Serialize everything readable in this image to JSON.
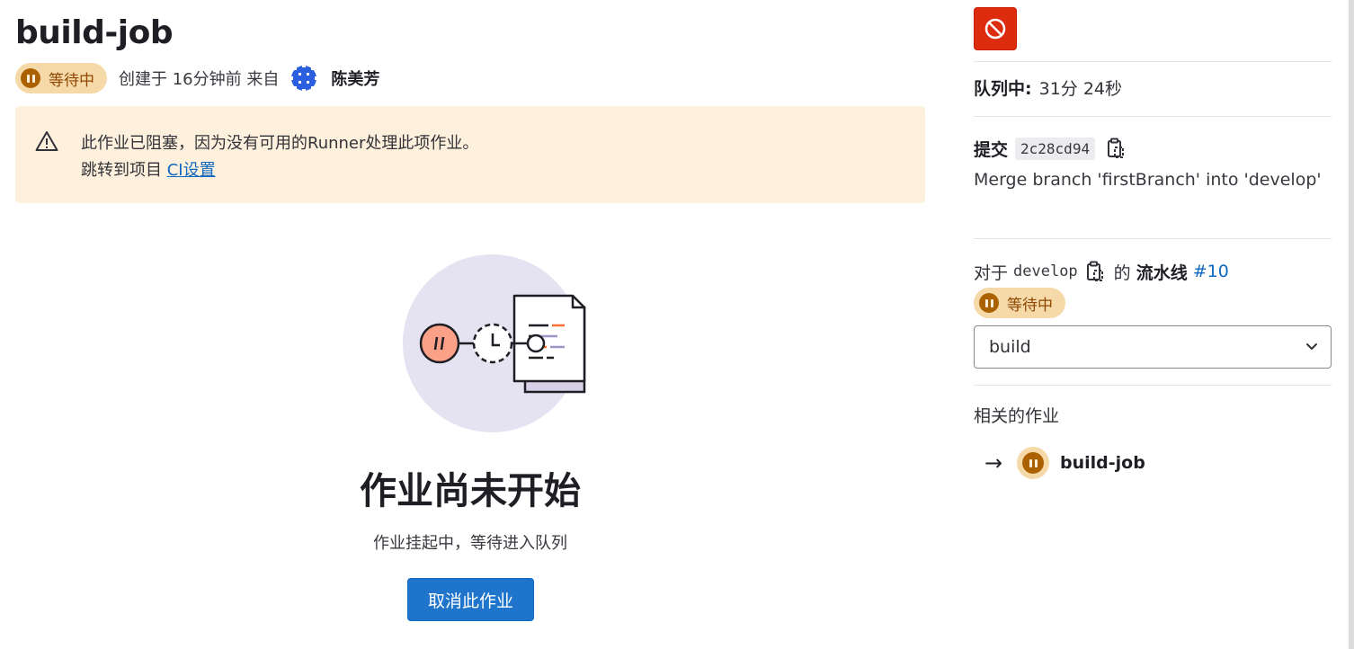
{
  "job": {
    "title": "build-job",
    "status_label": "等待中",
    "created_text": "创建于 16分钟前 来自",
    "author": "陈美芳"
  },
  "alert": {
    "line1": "此作业已阻塞，因为没有可用的Runner处理此项作业。",
    "line2_prefix": "跳转到项目 ",
    "link_text": "CI设置"
  },
  "empty_state": {
    "title": "作业尚未开始",
    "description": "作业挂起中，等待进入队列",
    "cancel_label": "取消此作业"
  },
  "sidebar": {
    "queued_label": "队列中:",
    "queued_value": "31分 24秒",
    "commit_label": "提交",
    "commit_sha": "2c28cd94",
    "commit_message": "Merge branch 'firstBranch' into 'develop'",
    "pipeline_prefix": "对于",
    "branch": "develop",
    "pipeline_of": "的",
    "pipeline_label": "流水线",
    "pipeline_id": "#10",
    "pipeline_status": "等待中",
    "stage_value": "build",
    "related_title": "相关的作业",
    "related_arrow": "→",
    "related_job": "build-job"
  },
  "colors": {
    "pending_bg": "#f5d9a8",
    "pending_icon": "#ab6100",
    "alert_bg": "#fdf1dd",
    "primary": "#1f75cb",
    "danger": "#dd2b0e",
    "link": "#1068bf"
  },
  "icons": {
    "status": "status-pending-icon",
    "warning": "warning-icon",
    "erase": "cancel-circle-icon",
    "copy": "copy-to-clipboard-icon",
    "chevron": "chevron-down-icon"
  }
}
